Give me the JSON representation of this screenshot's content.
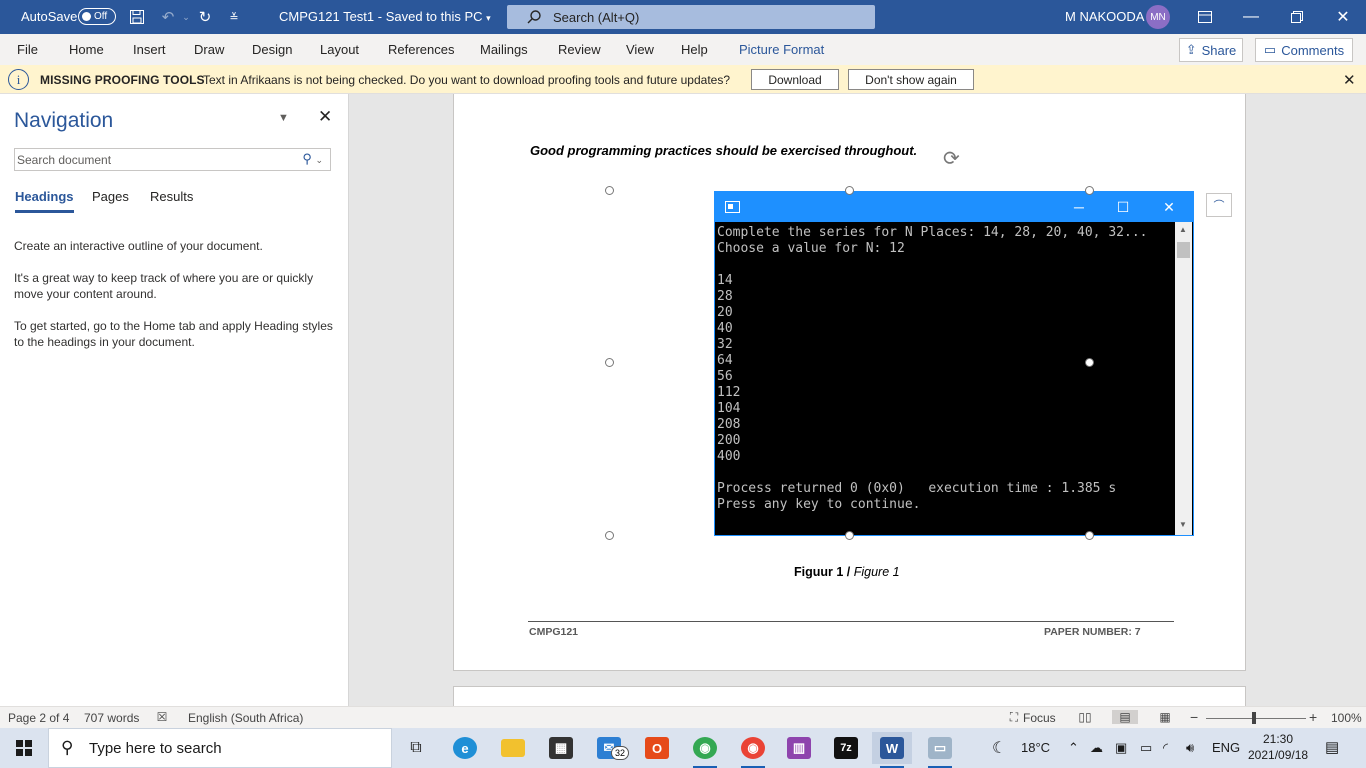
{
  "titlebar": {
    "autosave_label": "AutoSave",
    "autosave_state": "Off",
    "doc_title": "CMPG121 Test1  -  Saved to this PC",
    "search_placeholder": "Search (Alt+Q)",
    "user_name": "M NAKOODA",
    "user_initials": "MN"
  },
  "ribbon": {
    "tabs": [
      "File",
      "Home",
      "Insert",
      "Draw",
      "Design",
      "Layout",
      "References",
      "Mailings",
      "Review",
      "View",
      "Help",
      "Picture Format"
    ],
    "active_tab": "Picture Format",
    "share_label": "Share",
    "comments_label": "Comments"
  },
  "messagebar": {
    "title": "MISSING PROOFING TOOLS",
    "text": "Text in Afrikaans is not being checked. Do you want to download proofing tools and future updates?",
    "download_label": "Download",
    "dismiss_label": "Don't show again"
  },
  "navigation": {
    "title": "Navigation",
    "search_placeholder": "Search document",
    "tabs": [
      "Headings",
      "Pages",
      "Results"
    ],
    "paragraphs": [
      "Create an interactive outline of your document.",
      "It's a great way to keep track of where you are or quickly move your content around.",
      "To get started, go to the Home tab and apply Heading styles to the headings in your document."
    ]
  },
  "document": {
    "instruction": "Good programming practices should be exercised throughout.",
    "caption_bold": "Figuur 1 / ",
    "caption_italic": "Figure 1",
    "footer_left": "CMPG121",
    "footer_right": "PAPER NUMBER: 7",
    "console_text": "Complete the series for N Places: 14, 28, 20, 40, 32...\nChoose a value for N: 12\n\n14\n28\n20\n40\n32\n64\n56\n112\n104\n208\n200\n400\n\nProcess returned 0 (0x0)   execution time : 1.385 s\nPress any key to continue."
  },
  "statusbar": {
    "page": "Page 2 of 4",
    "words": "707 words",
    "language": "English (South Africa)",
    "focus": "Focus",
    "zoom": "100%"
  },
  "taskbar": {
    "search_placeholder": "Type here to search",
    "mail_badge": "32",
    "weather": "18°C",
    "input_lang": "ENG",
    "time": "21:30",
    "date": "2021/09/18"
  },
  "colors": {
    "word_blue": "#2b579a",
    "message_bg": "#fff4ce",
    "console_title": "#1e90ff"
  }
}
